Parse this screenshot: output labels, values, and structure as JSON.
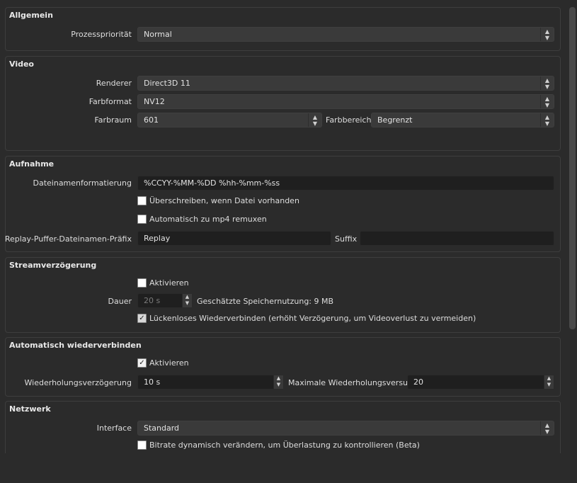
{
  "allgemein": {
    "title": "Allgemein",
    "prozess_label": "Prozesspriorität",
    "prozess_value": "Normal"
  },
  "video": {
    "title": "Video",
    "renderer_label": "Renderer",
    "renderer_value": "Direct3D 11",
    "farbformat_label": "Farbformat",
    "farbformat_value": "NV12",
    "farbraum_label": "Farbraum",
    "farbraum_value": "601",
    "farbbereich_label": "Farbbereich",
    "farbbereich_value": "Begrenzt"
  },
  "aufnahme": {
    "title": "Aufnahme",
    "dateiname_label": "Dateinamenformatierung",
    "dateiname_value": "%CCYY-%MM-%DD %hh-%mm-%ss",
    "overwrite_label": "Überschreiben, wenn Datei vorhanden",
    "overwrite_checked": false,
    "remux_label": "Automatisch zu mp4 remuxen",
    "remux_checked": false,
    "replay_label": "Replay-Puffer-Dateinamen-Präfix",
    "replay_value": "Replay",
    "suffix_label": "Suffix",
    "suffix_value": ""
  },
  "streamverzoegerung": {
    "title": "Streamverzögerung",
    "aktivieren_label": "Aktivieren",
    "aktivieren_checked": false,
    "dauer_label": "Dauer",
    "dauer_value": "20 s",
    "speicher_text": "Geschätzte Speichernutzung: 9 MB",
    "lueckenlos_label": "Lückenloses Wiederverbinden (erhöht Verzögerung, um Videoverlust zu vermeiden)",
    "lueckenlos_checked": true
  },
  "auto_reconnect": {
    "title": "Automatisch wiederverbinden",
    "aktivieren_label": "Aktivieren",
    "aktivieren_checked": true,
    "delay_label": "Wiederholungsverzögerung",
    "delay_value": "10 s",
    "max_label": "Maximale Wiederholungsversuche",
    "max_value": "20"
  },
  "netzwerk": {
    "title": "Netzwerk",
    "interface_label": "Interface",
    "interface_value": "Standard",
    "bitrate_label": "Bitrate dynamisch verändern, um Überlastung zu kontrollieren (Beta)",
    "bitrate_checked": false
  },
  "icons": {
    "combo_arrow": "updown-chevron-icon",
    "spin_arrow": "spin-arrows-icon",
    "checkmark": "checkmark-icon"
  },
  "colors": {
    "background": "#2b2b2b",
    "group_border": "#3e3e3e",
    "combo_bg": "#3a3a3a",
    "edit_bg": "#1f1f1f",
    "text": "#dedede"
  }
}
